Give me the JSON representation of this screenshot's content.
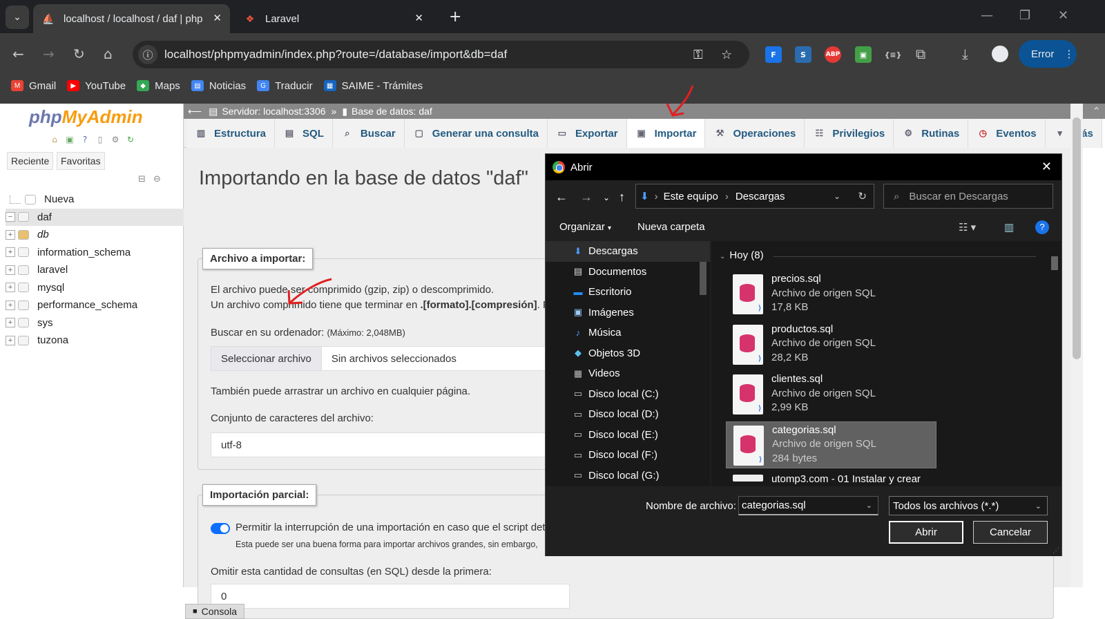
{
  "browser": {
    "tabs": [
      {
        "title": "localhost / localhost / daf | php",
        "favicon": "phpmyadmin-icon"
      },
      {
        "title": "Laravel",
        "favicon": "laravel-icon"
      }
    ],
    "url": "localhost/phpmyadmin/index.php?route=/database/import&db=daf",
    "profile_label": "Error",
    "extensions": [
      {
        "name": "fe-extension-icon",
        "label": "F",
        "color": "#1a73e8"
      },
      {
        "name": "s-extension-icon",
        "label": "S",
        "color": "#2b6cb0"
      },
      {
        "name": "abp-extension-icon",
        "label": "ABP",
        "color": "#e53935"
      },
      {
        "name": "green-extension-icon",
        "label": "▣",
        "color": "#43a047"
      },
      {
        "name": "json-extension-icon",
        "label": "{≡}",
        "color": "#3c3c3c"
      }
    ],
    "bookmarks": [
      {
        "label": "Gmail",
        "icon": "gmail-icon",
        "color": "#ea4335",
        "glyph": "M"
      },
      {
        "label": "YouTube",
        "icon": "youtube-icon",
        "color": "#ff0000",
        "glyph": "▶"
      },
      {
        "label": "Maps",
        "icon": "maps-icon",
        "color": "#34a853",
        "glyph": "◆"
      },
      {
        "label": "Noticias",
        "icon": "news-icon",
        "color": "#4285f4",
        "glyph": "▤"
      },
      {
        "label": "Traducir",
        "icon": "translate-icon",
        "color": "#4285f4",
        "glyph": "G"
      },
      {
        "label": "SAIME - Trámites",
        "icon": "saime-icon",
        "color": "#1565c0",
        "glyph": "▦"
      }
    ]
  },
  "sidebar": {
    "logo_php": "php",
    "logo_my": "MyAdmin",
    "buttons": {
      "recent": "Reciente",
      "favorites": "Favoritas"
    },
    "tree": [
      {
        "label": "Nueva",
        "type": "new"
      },
      {
        "label": "daf",
        "type": "db",
        "expanded": true,
        "selected": true
      },
      {
        "label": "db",
        "type": "db-italic"
      },
      {
        "label": "information_schema",
        "type": "db"
      },
      {
        "label": "laravel",
        "type": "db"
      },
      {
        "label": "mysql",
        "type": "db"
      },
      {
        "label": "performance_schema",
        "type": "db"
      },
      {
        "label": "sys",
        "type": "db"
      },
      {
        "label": "tuzona",
        "type": "db"
      }
    ]
  },
  "main": {
    "breadcrumb": {
      "server": "Servidor: localhost:3306",
      "sep": "»",
      "database": "Base de datos: daf"
    },
    "tabs": [
      {
        "label": "Estructura",
        "icon": "structure-icon"
      },
      {
        "label": "SQL",
        "icon": "sql-icon"
      },
      {
        "label": "Buscar",
        "icon": "search-icon"
      },
      {
        "label": "Generar una consulta",
        "icon": "query-icon"
      },
      {
        "label": "Exportar",
        "icon": "export-icon"
      },
      {
        "label": "Importar",
        "icon": "import-icon",
        "active": true
      },
      {
        "label": "Operaciones",
        "icon": "wrench-icon"
      },
      {
        "label": "Privilegios",
        "icon": "privileges-icon"
      },
      {
        "label": "Rutinas",
        "icon": "routines-icon"
      },
      {
        "label": "Eventos",
        "icon": "events-icon"
      },
      {
        "label": "Más",
        "icon": "more-icon"
      }
    ],
    "title": "Importando en la base de datos \"daf\"",
    "file_section": {
      "legend": "Archivo a importar:",
      "line1": "El archivo puede ser comprimido (gzip, zip) o descomprimido.",
      "line2_a": "Un archivo comprimido tiene que terminar en ",
      "line2_b": ".[formato].[compresión]",
      "line2_c": ". Po",
      "browse_label": "Buscar en su ordenador: ",
      "max_size": "(Máximo: 2,048MB)",
      "choose_button": "Seleccionar archivo",
      "no_file": "Sin archivos seleccionados",
      "drag_hint": "También puede arrastrar un archivo en cualquier página.",
      "charset_label": "Conjunto de caracteres del archivo:",
      "charset_value": "utf-8"
    },
    "partial_section": {
      "legend": "Importación parcial:",
      "allow_interrupt": "Permitir la interrupción de una importación en caso que el script detec",
      "interrupt_hint": "Esta puede ser una buena forma para importar archivos grandes, sin embargo, ",
      "skip_label": "Omitir esta cantidad de consultas (en SQL) desde la primera:",
      "skip_value": "0"
    },
    "console_label": "Consola"
  },
  "dialog": {
    "title": "Abrir",
    "path": [
      "Este equipo",
      "Descargas"
    ],
    "search_placeholder": "Buscar en Descargas",
    "organize": "Organizar",
    "new_folder": "Nueva carpeta",
    "nav_items": [
      {
        "label": "Descargas",
        "icon": "download-folder-icon",
        "glyph": "⬇",
        "color": "#4a9eff",
        "selected": true
      },
      {
        "label": "Documentos",
        "icon": "documents-icon",
        "glyph": "▤",
        "color": "#ddd"
      },
      {
        "label": "Escritorio",
        "icon": "desktop-icon",
        "glyph": "▬",
        "color": "#1e90ff"
      },
      {
        "label": "Imágenes",
        "icon": "images-icon",
        "glyph": "▣",
        "color": "#9ecbff"
      },
      {
        "label": "Música",
        "icon": "music-icon",
        "glyph": "♪",
        "color": "#4a9eff"
      },
      {
        "label": "Objetos 3D",
        "icon": "3d-objects-icon",
        "glyph": "◆",
        "color": "#5bc0eb"
      },
      {
        "label": "Videos",
        "icon": "videos-icon",
        "glyph": "▦",
        "color": "#bbb"
      },
      {
        "label": "Disco local (C:)",
        "icon": "drive-icon",
        "glyph": "▭",
        "color": "#ccc"
      },
      {
        "label": "Disco local (D:)",
        "icon": "drive-icon",
        "glyph": "▭",
        "color": "#ccc"
      },
      {
        "label": "Disco local (E:)",
        "icon": "drive-icon",
        "glyph": "▭",
        "color": "#ccc"
      },
      {
        "label": "Disco local (F:)",
        "icon": "drive-icon",
        "glyph": "▭",
        "color": "#ccc"
      },
      {
        "label": "Disco local (G:)",
        "icon": "drive-icon",
        "glyph": "▭",
        "color": "#ccc"
      }
    ],
    "group_label": "Hoy (8)",
    "files": [
      {
        "name": "precios.sql",
        "type": "Archivo de origen SQL",
        "size": "17,8 KB"
      },
      {
        "name": "productos.sql",
        "type": "Archivo de origen SQL",
        "size": "28,2 KB"
      },
      {
        "name": "clientes.sql",
        "type": "Archivo de origen SQL",
        "size": "2,99 KB"
      },
      {
        "name": "categorias.sql",
        "type": "Archivo de origen SQL",
        "size": "284 bytes",
        "selected": true
      },
      {
        "name": "utomp3.com - 01  Instalar y crear",
        "type": "",
        "size": ""
      }
    ],
    "filename_label": "Nombre de archivo:",
    "filename_value": "categorias.sql",
    "filetype_value": "Todos los archivos (*.*)",
    "open_button": "Abrir",
    "cancel_button": "Cancelar"
  }
}
